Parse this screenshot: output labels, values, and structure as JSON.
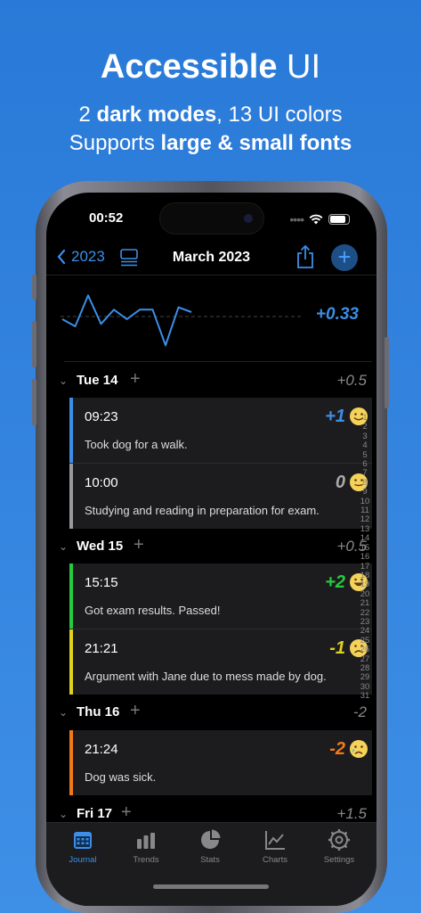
{
  "promo": {
    "title_bold": "Accessible",
    "title_rest": " UI",
    "line1_pre": "2 ",
    "line1_bold": "dark modes",
    "line1_post": ", 13 UI colors",
    "line2_pre": "Supports ",
    "line2_bold": "large & small fonts"
  },
  "status_bar": {
    "time": "00:52",
    "dots": "••••"
  },
  "navbar": {
    "back_label": "2023",
    "title": "March 2023"
  },
  "summary": {
    "average": "+0.33",
    "sparkline_values": [
      0.5,
      0.2,
      1.5,
      0.3,
      0.9,
      0.5,
      0.9,
      0.9,
      -0.6,
      1.0,
      0.8
    ]
  },
  "days": [
    {
      "label": "Tue 14",
      "score": "+0.5",
      "entries": [
        {
          "time": "09:23",
          "score": "+1",
          "text": "Took dog for a walk.",
          "mood": "happy",
          "color": "#3b8fe8"
        },
        {
          "time": "10:00",
          "score": "0",
          "text": "Studying and reading in preparation for exam.",
          "mood": "neutral",
          "color": "#9a9a9a"
        }
      ]
    },
    {
      "label": "Wed 15",
      "score": "+0.5",
      "entries": [
        {
          "time": "15:15",
          "score": "+2",
          "text": "Got exam results. Passed!",
          "mood": "very-happy",
          "color": "#27c93f"
        },
        {
          "time": "21:21",
          "score": "-1",
          "text": "Argument with Jane due to mess made by dog.",
          "mood": "sad",
          "color": "#e0d020"
        }
      ]
    },
    {
      "label": "Thu 16",
      "score": "-2",
      "entries": [
        {
          "time": "21:24",
          "score": "-2",
          "text": "Dog was sick.",
          "mood": "crying",
          "color": "#f07a1a"
        }
      ]
    },
    {
      "label": "Fri 17",
      "score": "+1.5",
      "entries": []
    }
  ],
  "index_numbers": [
    "1",
    "2",
    "3",
    "4",
    "5",
    "6",
    "7",
    "8",
    "9",
    "10",
    "11",
    "12",
    "13",
    "14",
    "15",
    "16",
    "17",
    "18",
    "19",
    "20",
    "21",
    "22",
    "23",
    "24",
    "25",
    "26",
    "27",
    "28",
    "29",
    "30",
    "31"
  ],
  "tabs": [
    {
      "label": "Journal",
      "icon": "calendar-icon",
      "active": true
    },
    {
      "label": "Trends",
      "icon": "bar-chart-icon",
      "active": false
    },
    {
      "label": "Stats",
      "icon": "pie-chart-icon",
      "active": false
    },
    {
      "label": "Charts",
      "icon": "line-chart-icon",
      "active": false
    },
    {
      "label": "Settings",
      "icon": "gear-icon",
      "active": false
    }
  ],
  "colors": {
    "accent": "#3b8fe8",
    "background": "#000000",
    "card": "#1c1c1e"
  }
}
